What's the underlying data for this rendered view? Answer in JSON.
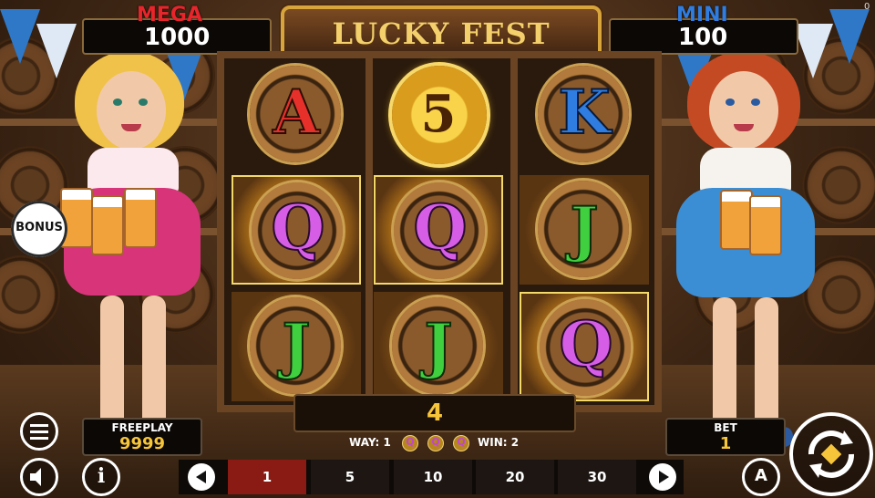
{
  "game": {
    "title": "LUCKY FEST",
    "corner_mark": "0"
  },
  "jackpots": {
    "mega": {
      "label": "MEGA",
      "value": "1000",
      "label_color": "#e8252b"
    },
    "mini": {
      "label": "MINI",
      "value": "100",
      "label_color": "#2f7de0"
    }
  },
  "reels": {
    "rows": [
      [
        {
          "symbol": "A",
          "win": false
        },
        {
          "symbol": "5",
          "win": false,
          "coin": true
        },
        {
          "symbol": "K",
          "win": false
        }
      ],
      [
        {
          "symbol": "Q",
          "win": true
        },
        {
          "symbol": "Q",
          "win": true
        },
        {
          "symbol": "J",
          "win": false
        }
      ],
      [
        {
          "symbol": "J",
          "win": false
        },
        {
          "symbol": "J",
          "win": false
        },
        {
          "symbol": "Q",
          "win": true
        }
      ]
    ]
  },
  "win_display": {
    "value": "4"
  },
  "ways": {
    "way_label": "WAY: 1",
    "win_label": "WIN: 2",
    "symbols": [
      "Q",
      "Q",
      "Q"
    ]
  },
  "freeplay": {
    "label": "FREEPLAY",
    "value": "9999"
  },
  "bet": {
    "label": "BET",
    "value": "1"
  },
  "bet_options": [
    {
      "label": "1",
      "selected": true
    },
    {
      "label": "5",
      "selected": false
    },
    {
      "label": "10",
      "selected": false
    },
    {
      "label": "20",
      "selected": false
    },
    {
      "label": "30",
      "selected": false
    }
  ],
  "buttons": {
    "bonus": "BONUS",
    "menu_icon": "hamburger-menu-icon",
    "sound_icon": "speaker-icon",
    "info_icon": "info-icon",
    "autoplay_icon": "autoplay-a-icon",
    "spin_icon": "spin-arrows-icon"
  },
  "colors": {
    "accent_gold": "#f7c53a",
    "selected_bet": "#8a1a14"
  }
}
